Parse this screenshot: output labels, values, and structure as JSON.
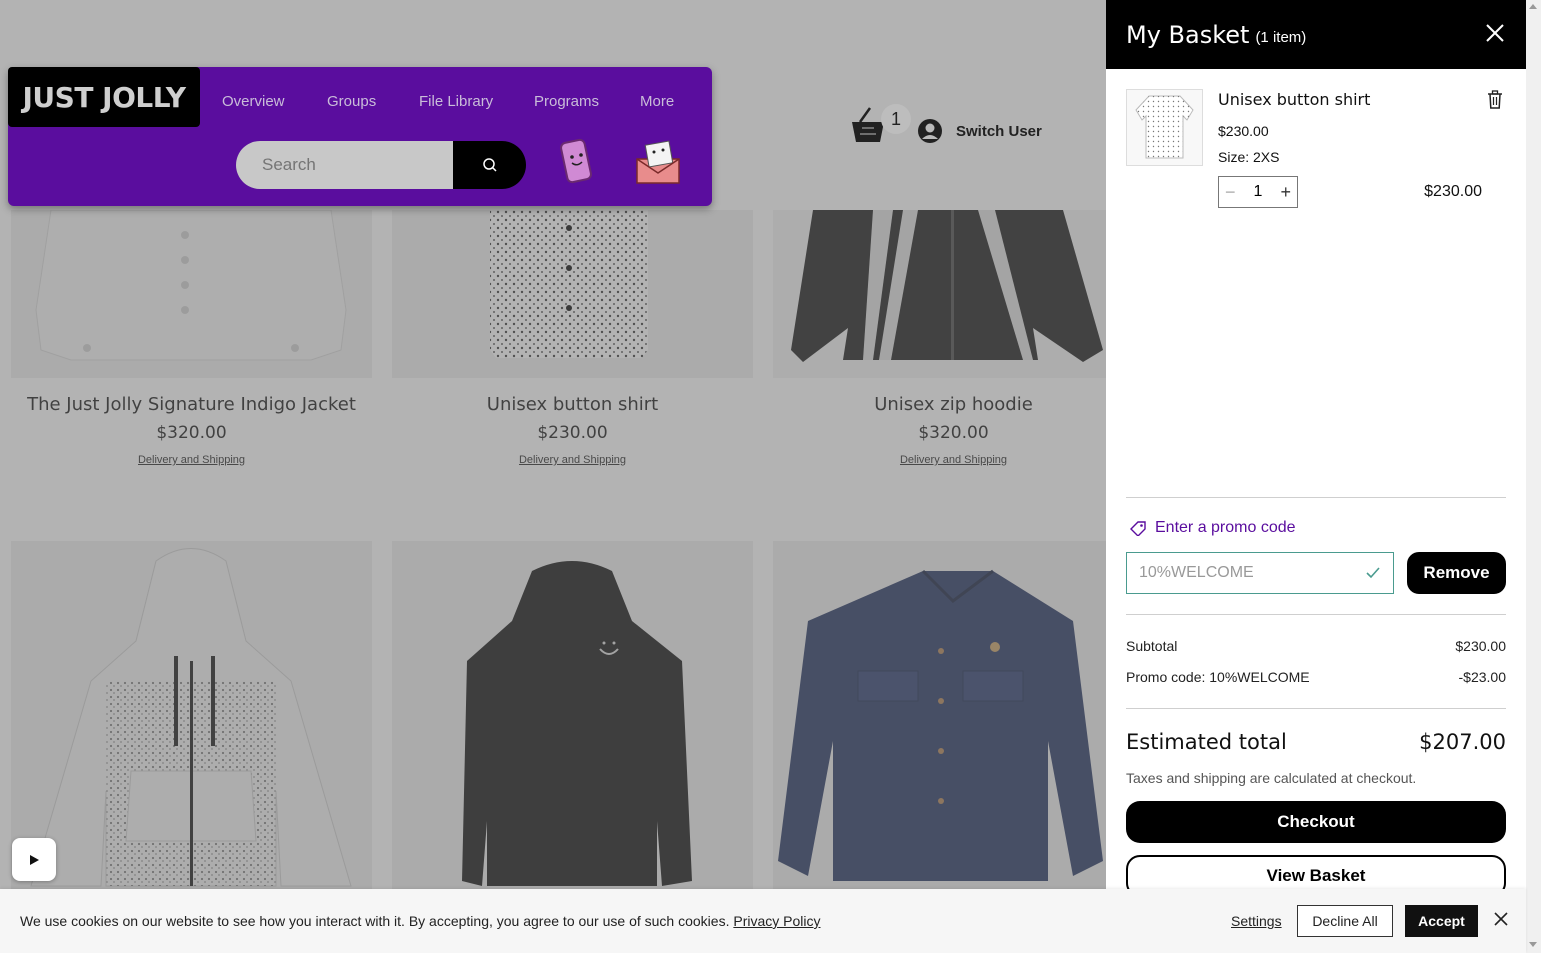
{
  "header": {
    "logo": "JUST JOLLY",
    "nav": [
      "Overview",
      "Groups",
      "File Library",
      "Programs",
      "More"
    ],
    "search_placeholder": "Search",
    "cart_count": "1",
    "switch_user": "Switch User"
  },
  "products_row1": [
    {
      "title": "The Just Jolly Signature Indigo Jacket",
      "price": "$320.00",
      "link": "Delivery and Shipping"
    },
    {
      "title": "Unisex button shirt",
      "price": "$230.00",
      "link": "Delivery and Shipping"
    },
    {
      "title": "Unisex zip hoodie",
      "price": "$320.00",
      "link": "Delivery and Shipping"
    }
  ],
  "basket": {
    "title": "My Basket",
    "count": "(1 item)",
    "item": {
      "name": "Unisex button shirt",
      "price": "$230.00",
      "size": "Size: 2XS",
      "qty": "1",
      "total": "$230.00"
    },
    "promo_label": "Enter a promo code",
    "promo_value": "10%WELCOME",
    "remove_label": "Remove",
    "subtotal_label": "Subtotal",
    "subtotal_value": "$230.00",
    "promo_line_label": "Promo code: 10%WELCOME",
    "promo_line_value": "-$23.00",
    "est_label": "Estimated total",
    "est_value": "$207.00",
    "tax_note": "Taxes and shipping are calculated at checkout.",
    "checkout_label": "Checkout",
    "view_label": "View Basket"
  },
  "cookie": {
    "text": "We use cookies on our website to see how you interact with it. By accepting, you agree to our use of such cookies.",
    "policy": "Privacy Policy",
    "settings": "Settings",
    "decline": "Decline All",
    "accept": "Accept"
  },
  "colors": {
    "brand_purple": "#5a0d9e",
    "promo_border": "#4a9b8f"
  }
}
